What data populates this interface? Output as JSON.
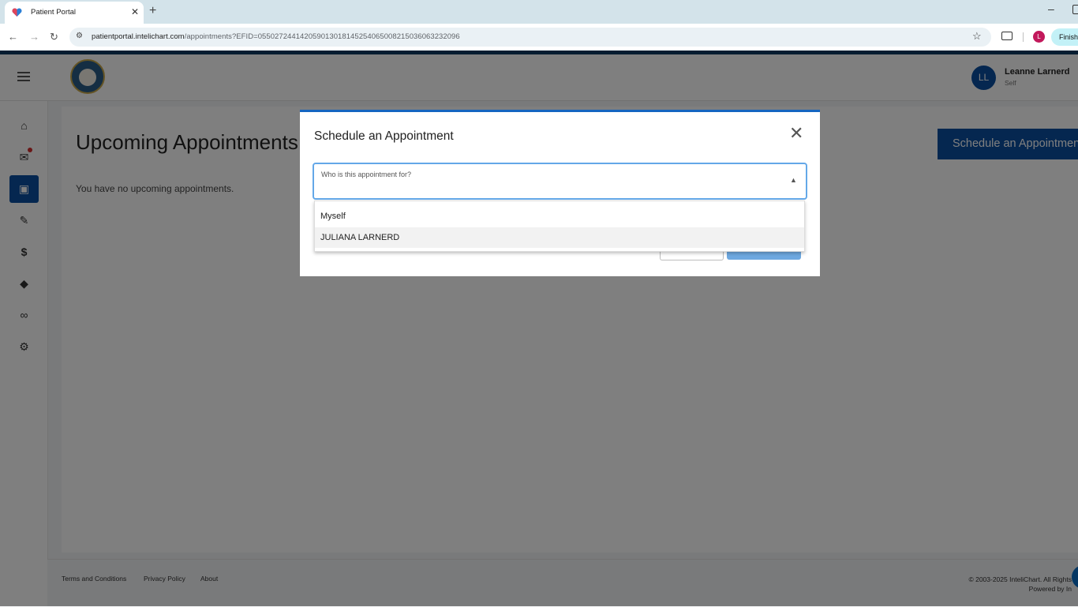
{
  "browser": {
    "tab_title": "Patient Portal",
    "url_host": "patientportal.intelichart.com",
    "url_path": "/appointments?EFID=055027244142059013018145254065008215036063232096",
    "profile_initial": "L",
    "finish_label": "Finish",
    "icons": {
      "back": "back-arrow-icon",
      "forward": "forward-arrow-icon",
      "reload": "reload-icon",
      "site_info": "site-info-icon",
      "bookmark": "star-icon",
      "cast": "cast-icon"
    }
  },
  "header": {
    "user_initials": "LL",
    "user_name": "Leanne Larnerd",
    "user_role": "Self"
  },
  "sidebar": {
    "items": [
      {
        "icon": "home-icon",
        "glyph": "⌂"
      },
      {
        "icon": "mail-icon",
        "glyph": "✉"
      },
      {
        "icon": "calendar-icon",
        "glyph": "▣"
      },
      {
        "icon": "clipboard-icon",
        "glyph": "✎"
      },
      {
        "icon": "dollar-icon",
        "glyph": "$"
      },
      {
        "icon": "education-icon",
        "glyph": "◆"
      },
      {
        "icon": "link-icon",
        "glyph": "∞"
      },
      {
        "icon": "settings-icon",
        "glyph": "⚙"
      }
    ],
    "active_index": 2
  },
  "main": {
    "title": "Upcoming Appointments",
    "empty_message": "You have no upcoming appointments.",
    "schedule_button": "Schedule an Appointment"
  },
  "footer": {
    "links": [
      "Terms and Conditions",
      "Privacy Policy",
      "About"
    ],
    "copyright_line1": "© 2003-2025 InteliChart. All Rights",
    "copyright_line2": "Powered by In"
  },
  "modal": {
    "title": "Schedule an Appointment",
    "select_label": "Who is this appointment for?",
    "options": [
      "Myself",
      "JULIANA LARNERD"
    ],
    "hovered_option": 1
  },
  "colors": {
    "brand_blue": "#0b4fa0",
    "modal_accent": "#1565c0",
    "select_focus": "#64a8e8"
  }
}
